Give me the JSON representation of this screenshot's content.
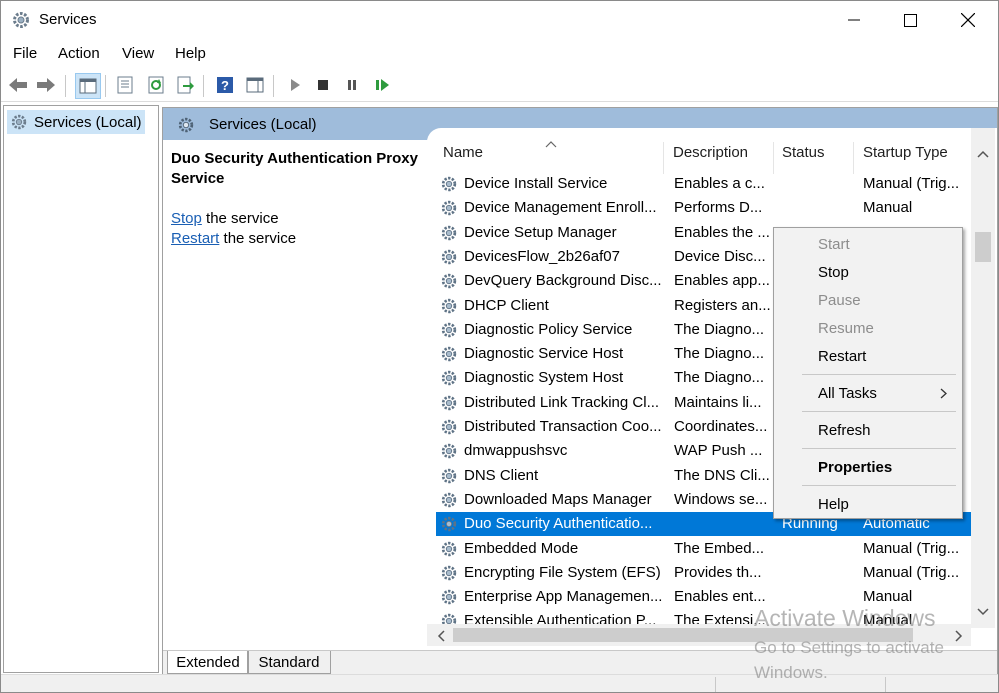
{
  "window": {
    "title": "Services"
  },
  "menu": [
    "File",
    "Action",
    "View",
    "Help"
  ],
  "tree": {
    "item": "Services (Local)"
  },
  "panel": {
    "header": "Services (Local)",
    "service_name": "Duo Security Authentication Proxy Service",
    "stop_link": "Stop",
    "stop_suffix": " the service",
    "restart_link": "Restart",
    "restart_suffix": " the service"
  },
  "columns": {
    "name": "Name",
    "description": "Description",
    "status": "Status",
    "startup": "Startup Type"
  },
  "rows": [
    {
      "name": "Device Install Service",
      "description": "Enables a c...",
      "status": "",
      "startup": "Manual (Trig..."
    },
    {
      "name": "Device Management Enroll...",
      "description": "Performs D...",
      "status": "",
      "startup": "Manual"
    },
    {
      "name": "Device Setup Manager",
      "description": "Enables the ...",
      "status": "",
      "startup": ""
    },
    {
      "name": "DevicesFlow_2b26af07",
      "description": "Device Disc...",
      "status": "",
      "startup": ""
    },
    {
      "name": "DevQuery Background Disc...",
      "description": "Enables app...",
      "status": "",
      "startup": ""
    },
    {
      "name": "DHCP Client",
      "description": "Registers an...",
      "status": "",
      "startup": ""
    },
    {
      "name": "Diagnostic Policy Service",
      "description": "The Diagno...",
      "status": "",
      "startup": ""
    },
    {
      "name": "Diagnostic Service Host",
      "description": "The Diagno...",
      "status": "",
      "startup": ""
    },
    {
      "name": "Diagnostic System Host",
      "description": "The Diagno...",
      "status": "",
      "startup": ""
    },
    {
      "name": "Distributed Link Tracking Cl...",
      "description": "Maintains li...",
      "status": "",
      "startup": ""
    },
    {
      "name": "Distributed Transaction Coo...",
      "description": "Coordinates...",
      "status": "",
      "startup": ""
    },
    {
      "name": "dmwappushsvc",
      "description": "WAP Push ...",
      "status": "",
      "startup": ""
    },
    {
      "name": "DNS Client",
      "description": "The DNS Cli...",
      "status": "",
      "startup": ""
    },
    {
      "name": "Downloaded Maps Manager",
      "description": "Windows se...",
      "status": "",
      "startup": ""
    },
    {
      "name": "Duo Security Authenticatio...",
      "description": "",
      "status": "Running",
      "startup": "Automatic"
    },
    {
      "name": "Embedded Mode",
      "description": "The Embed...",
      "status": "",
      "startup": "Manual (Trig..."
    },
    {
      "name": "Encrypting File System (EFS)",
      "description": "Provides th...",
      "status": "",
      "startup": "Manual (Trig..."
    },
    {
      "name": "Enterprise App Managemen...",
      "description": "Enables ent...",
      "status": "",
      "startup": "Manual"
    },
    {
      "name": "Extensible Authentication P...",
      "description": "The Extensi...",
      "status": "",
      "startup": "Manual"
    }
  ],
  "context_menu": {
    "start": "Start",
    "stop": "Stop",
    "pause": "Pause",
    "resume": "Resume",
    "restart": "Restart",
    "all_tasks": "All Tasks",
    "refresh": "Refresh",
    "properties": "Properties",
    "help": "Help"
  },
  "tabs": [
    "Extended",
    "Standard"
  ],
  "watermark": {
    "line1": "Activate Windows",
    "line2": "Go to Settings to activate",
    "line3": "Windows."
  },
  "colors": {
    "header_blue": "#9fbcdb",
    "selection": "#0078d7",
    "link": "#1a5fb4"
  },
  "icons": {
    "app": "gear-icon",
    "service": "gear-icon"
  }
}
